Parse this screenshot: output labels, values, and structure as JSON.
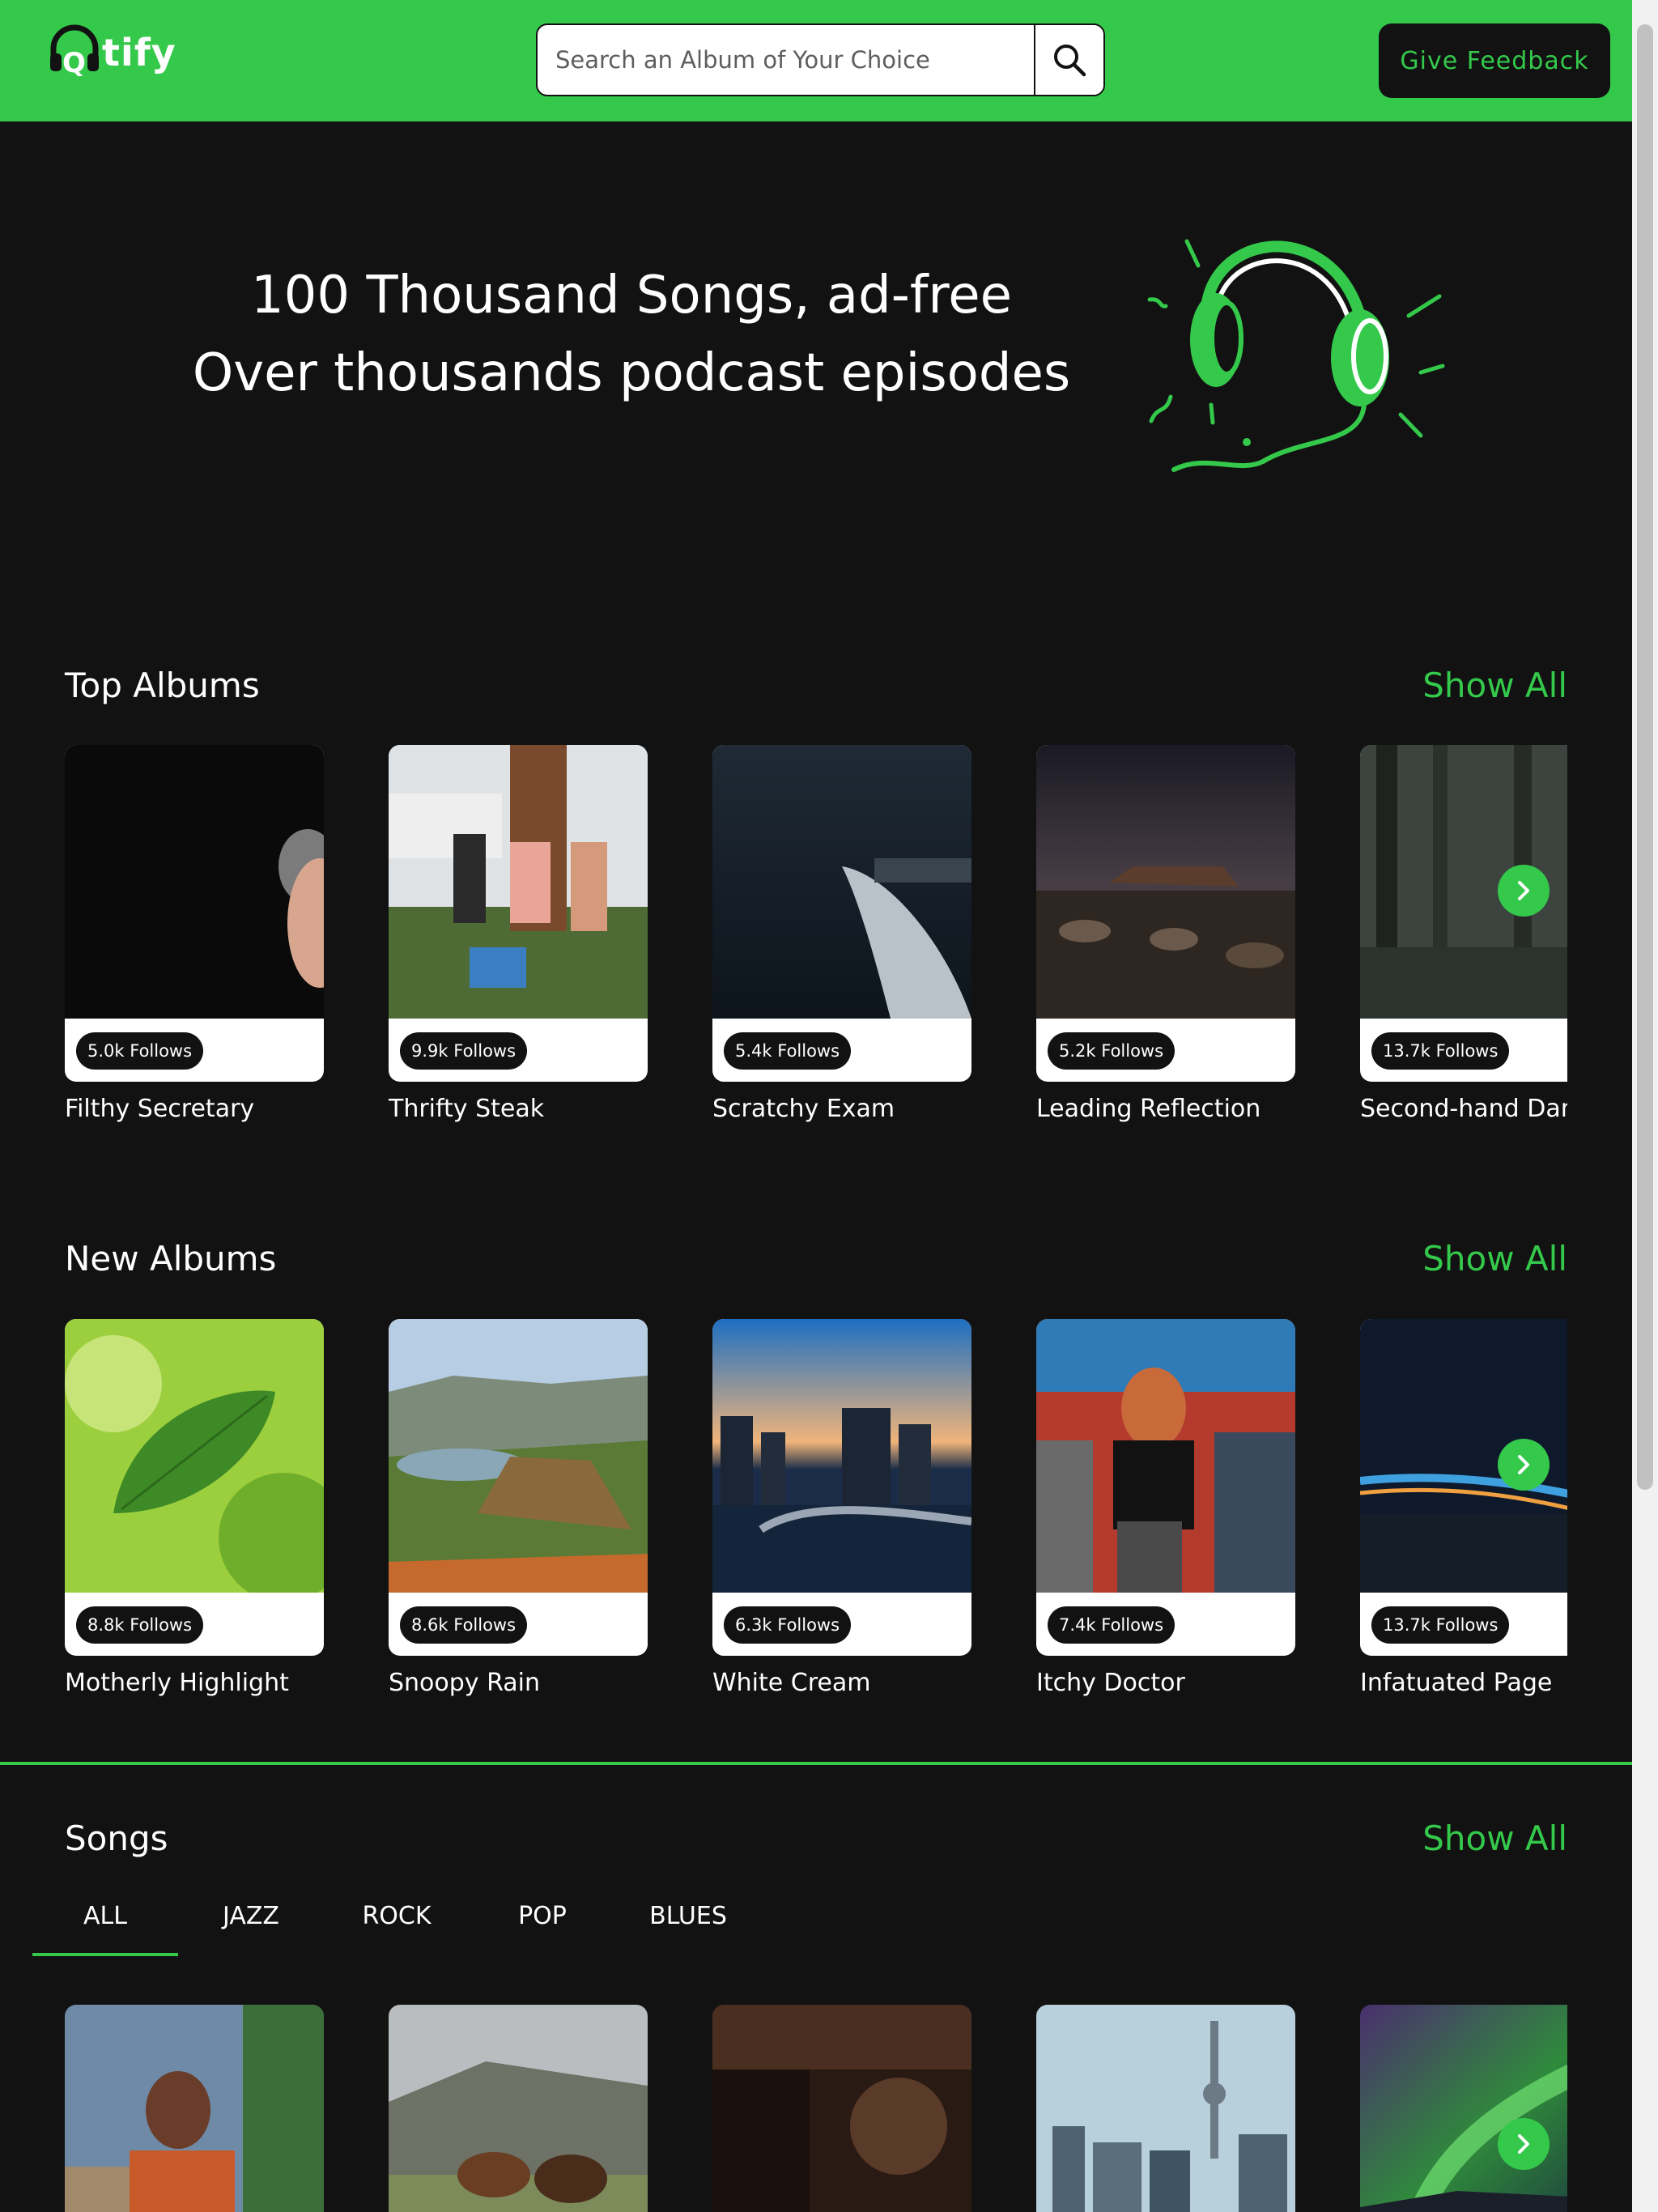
{
  "header": {
    "logo_text": "tify",
    "logo_letter": "Q",
    "search_placeholder": "Search an Album of Your Choice",
    "feedback_label": "Give Feedback"
  },
  "hero": {
    "line1": "100 Thousand Songs, ad-free",
    "line2": "Over thousands podcast episodes"
  },
  "top_albums": {
    "title": "Top Albums",
    "show_all": "Show All",
    "items": [
      {
        "name": "Filthy Secretary",
        "follows": "5.0k Follows"
      },
      {
        "name": "Thrifty Steak",
        "follows": "9.9k Follows"
      },
      {
        "name": "Scratchy Exam",
        "follows": "5.4k Follows"
      },
      {
        "name": "Leading Reflection",
        "follows": "5.2k Follows"
      },
      {
        "name": "Second-hand Dan",
        "follows": "13.7k Follows"
      }
    ]
  },
  "new_albums": {
    "title": "New Albums",
    "show_all": "Show All",
    "items": [
      {
        "name": "Motherly Highlight",
        "follows": "8.8k Follows"
      },
      {
        "name": "Snoopy Rain",
        "follows": "8.6k Follows"
      },
      {
        "name": "White Cream",
        "follows": "6.3k Follows"
      },
      {
        "name": "Itchy Doctor",
        "follows": "7.4k Follows"
      },
      {
        "name": "Infatuated Page",
        "follows": "13.7k Follows"
      }
    ]
  },
  "songs": {
    "title": "Songs",
    "show_all": "Show All",
    "tabs": [
      "ALL",
      "JAZZ",
      "ROCK",
      "POP",
      "BLUES"
    ],
    "active_tab": "ALL"
  },
  "colors": {
    "accent": "#34c94b",
    "background": "#121212"
  }
}
